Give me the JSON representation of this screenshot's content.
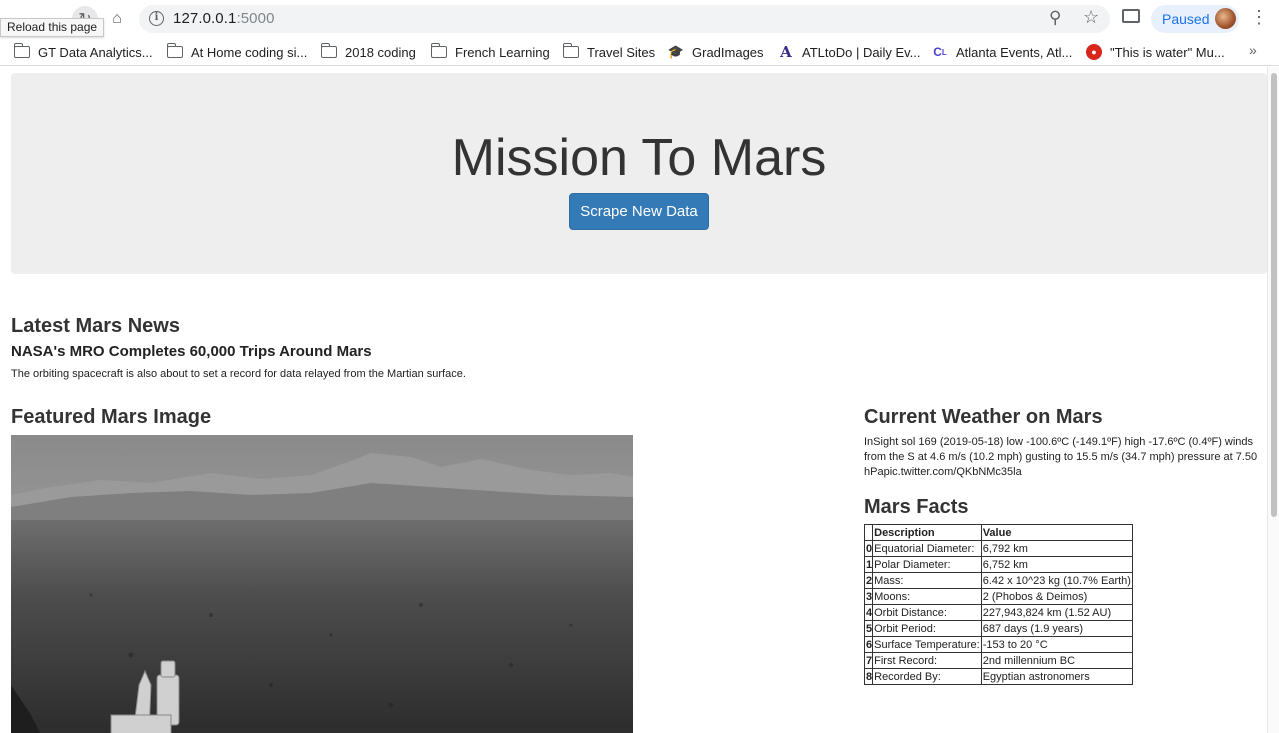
{
  "browser": {
    "tooltip": "Reload this page",
    "url_host": "127.0.0.1",
    "url_port": ":5000",
    "profile_label": "Paused",
    "more_bookmarks": "»"
  },
  "bookmarks": [
    {
      "label": "GT Data Analytics...",
      "icon": "folder-icon"
    },
    {
      "label": "At Home coding si...",
      "icon": "folder-icon"
    },
    {
      "label": "2018 coding",
      "icon": "folder-icon"
    },
    {
      "label": "French Learning",
      "icon": "folder-icon"
    },
    {
      "label": "Travel Sites",
      "icon": "folder-icon"
    },
    {
      "label": "GradImages",
      "icon": "graduation-cap-icon"
    },
    {
      "label": "ATLtoDo | Daily Ev...",
      "icon": "atltodo-icon"
    },
    {
      "label": "Atlanta Events, Atl...",
      "icon": "creative-loafing-icon"
    },
    {
      "label": "\"This is water\" Mu...",
      "icon": "red-circle-icon"
    }
  ],
  "page": {
    "title": "Mission To Mars",
    "scrape_button": "Scrape New Data",
    "news_heading": "Latest Mars News",
    "news_title": "NASA's MRO Completes 60,000 Trips Around Mars",
    "news_paragraph": "The orbiting spacecraft is also about to set a record for data relayed from the Martian surface.",
    "image_heading": "Featured Mars Image",
    "weather_heading": "Current Weather on Mars",
    "weather_text": "InSight sol 169 (2019-05-18) low -100.6ºC (-149.1ºF) high -17.6ºC (0.4ºF) winds\nfrom the S at 4.6 m/s (10.2 mph) gusting to 15.5 m/s (34.7 mph) pressure at 7.50\nhPapic.twitter.com/QKbNMc35la",
    "facts_heading": "Mars Facts",
    "facts_headers": [
      "Description",
      "Value"
    ],
    "facts_rows": [
      {
        "idx": "0",
        "desc": "Equatorial Diameter:",
        "value": "6,792 km"
      },
      {
        "idx": "1",
        "desc": "Polar Diameter:",
        "value": "6,752 km"
      },
      {
        "idx": "2",
        "desc": "Mass:",
        "value": "6.42 x 10^23 kg (10.7% Earth)"
      },
      {
        "idx": "3",
        "desc": "Moons:",
        "value": "2 (Phobos & Deimos)"
      },
      {
        "idx": "4",
        "desc": "Orbit Distance:",
        "value": "227,943,824 km (1.52 AU)"
      },
      {
        "idx": "5",
        "desc": "Orbit Period:",
        "value": "687 days (1.9 years)"
      },
      {
        "idx": "6",
        "desc": "Surface Temperature:",
        "value": "-153 to 20 °C"
      },
      {
        "idx": "7",
        "desc": "First Record:",
        "value": "2nd millennium BC"
      },
      {
        "idx": "8",
        "desc": "Recorded By:",
        "value": "Egyptian astronomers"
      }
    ]
  }
}
